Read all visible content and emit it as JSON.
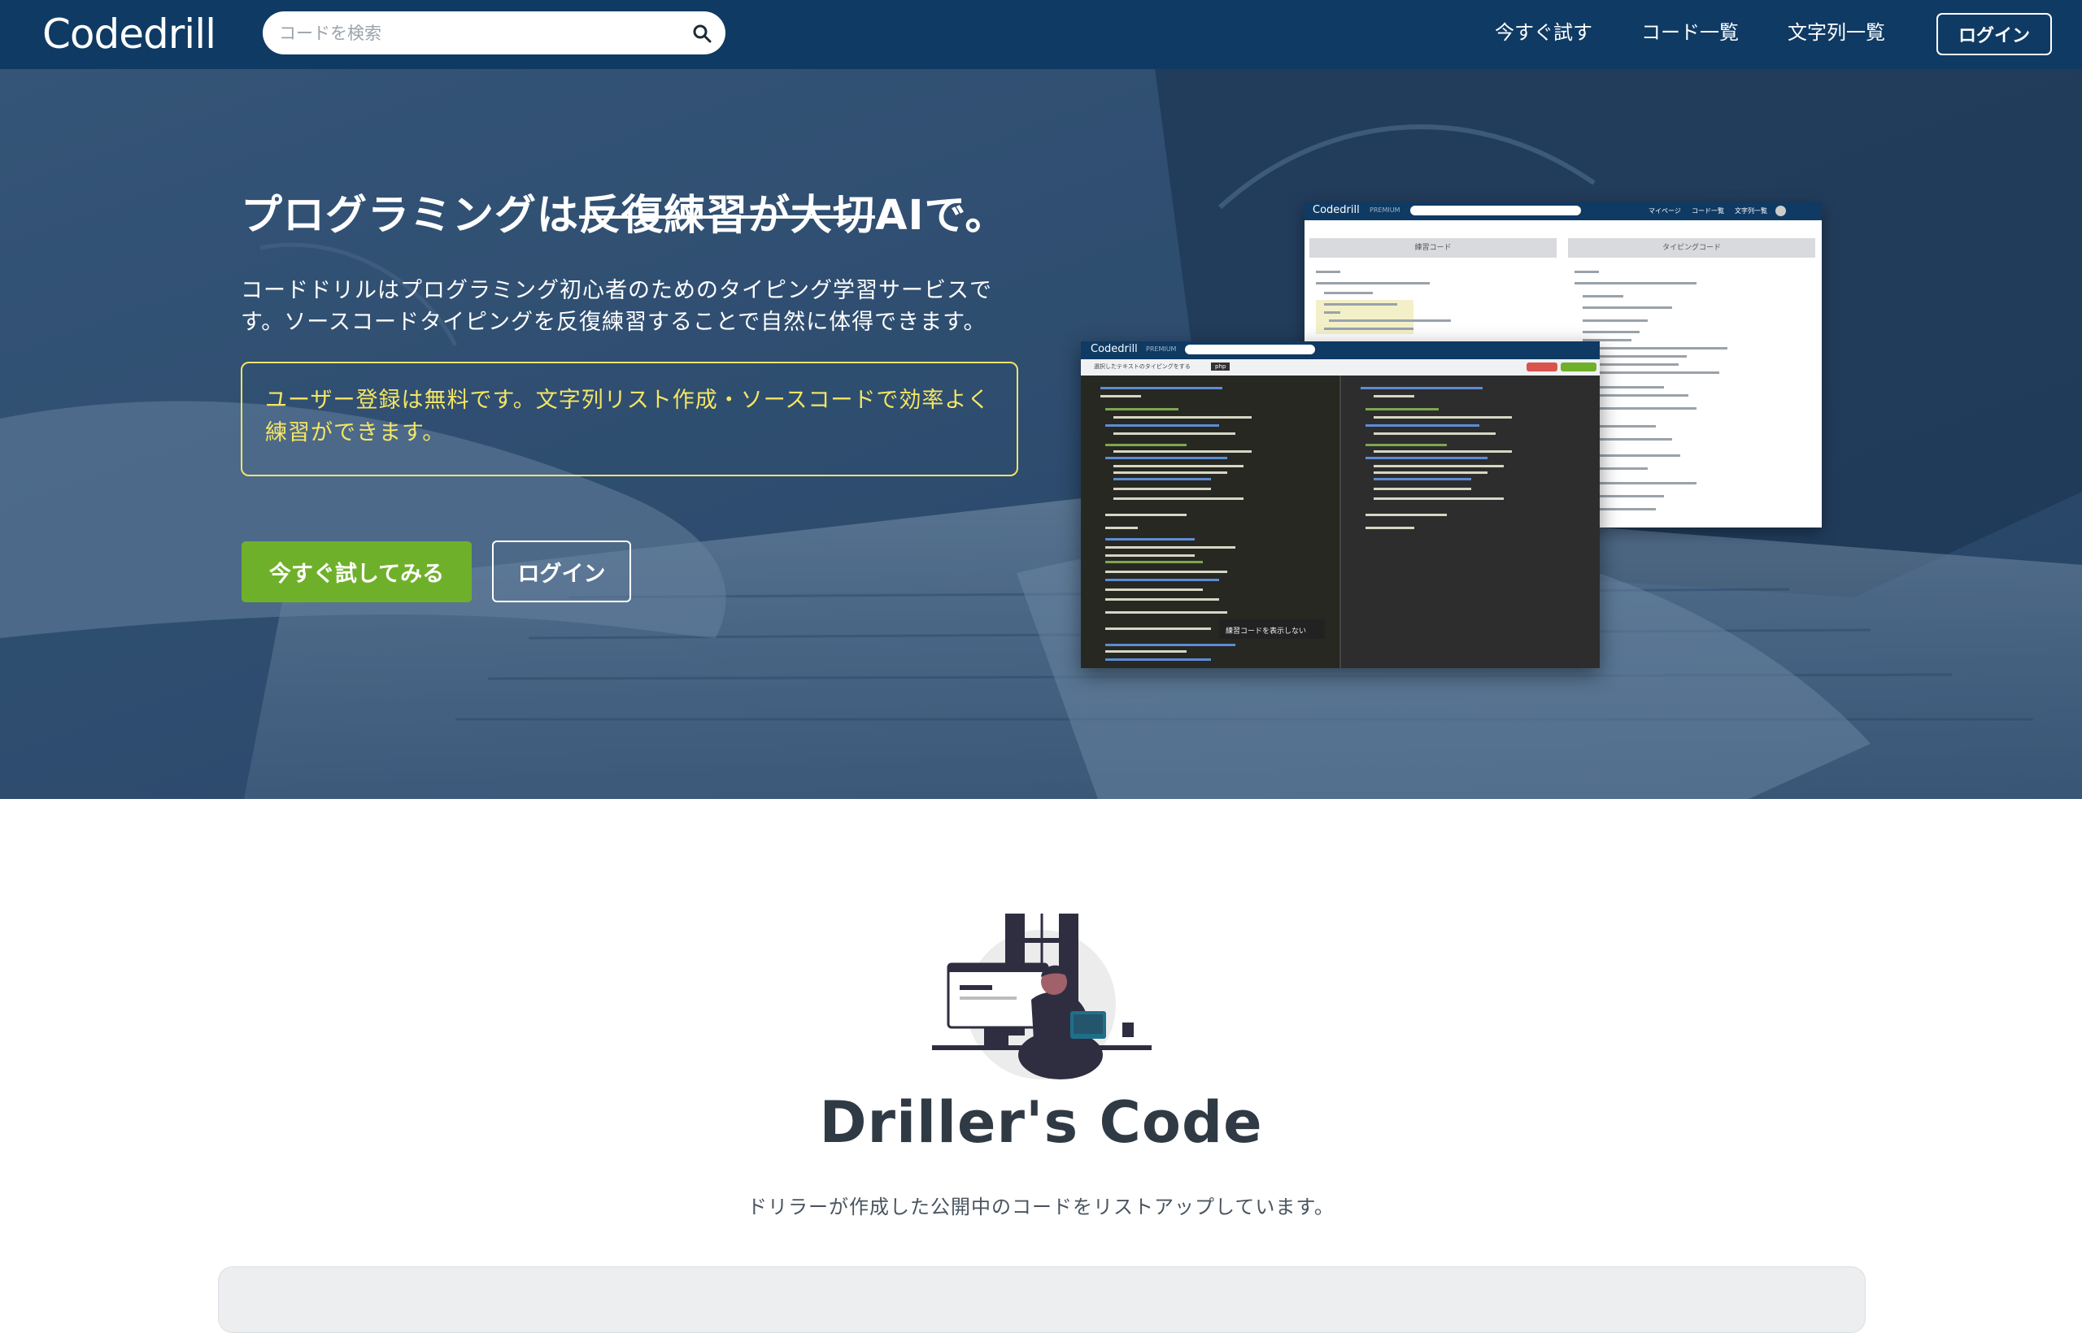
{
  "header": {
    "logo_text": "Codedrill",
    "search_placeholder": "コードを検索",
    "nav": [
      "今すぐ試す",
      "コード一覧",
      "文字列一覧"
    ],
    "login_label": "ログイン"
  },
  "hero": {
    "title_plain": "プログラミングは",
    "title_strike": "反復練習が大切",
    "title_tail": "AIで。",
    "description": "コードドリルはプログラミング初心者のためのタイピング学習サービスです。ソースコードタイピングを反復練習することで自然に体得できます。",
    "note": "ユーザー登録は無料です。文字列リスト作成・ソースコードで効率よく練習ができます。",
    "try_button": "今すぐ試してみる",
    "login_button": "ログイン"
  },
  "preview_back": {
    "logo": "Codedrill",
    "badge": "PREMIUM",
    "nav": [
      "マイページ",
      "コード一覧",
      "文字列一覧"
    ],
    "panel_left": "練習コード",
    "panel_right": "タイピングコード"
  },
  "preview_front": {
    "logo": "Codedrill",
    "badge": "PREMIUM",
    "toolbar_label": "選択したテキストのタイピングをする",
    "lang_tag": "php",
    "overlay_text": "練習コードを表示しない"
  },
  "section": {
    "title": "Driller's Code",
    "subtitle": "ドリラーが作成した公開中のコードをリストアップしています。"
  },
  "colors": {
    "navbar": "#0f3a63",
    "accent_green": "#6fb02b",
    "note_yellow": "#f5e663"
  }
}
